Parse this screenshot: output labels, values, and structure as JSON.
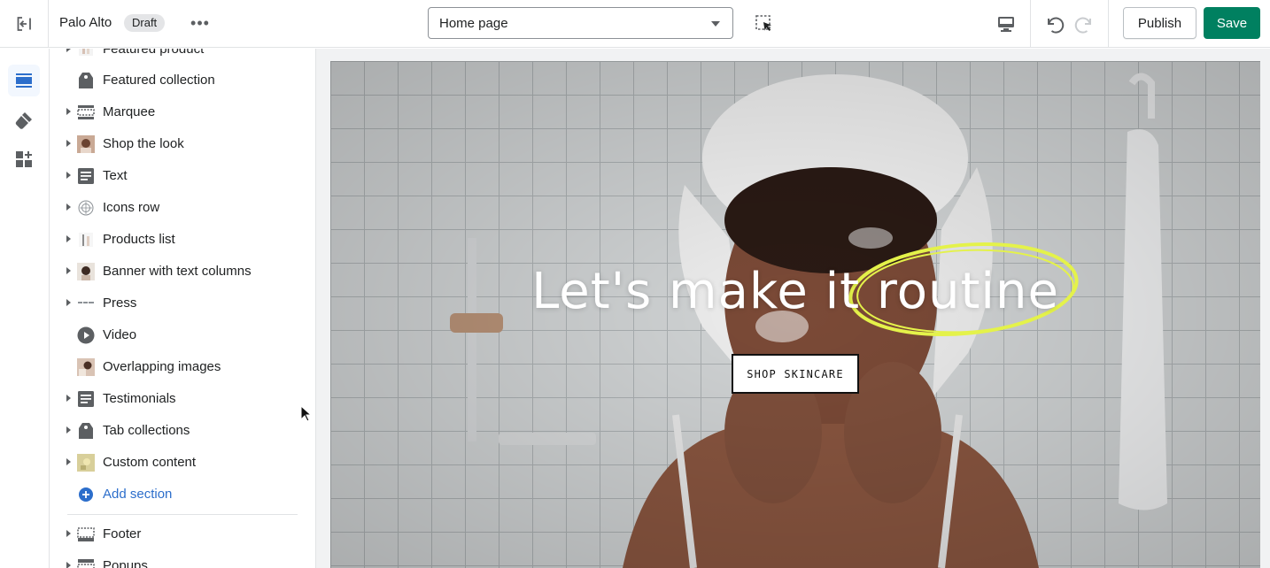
{
  "topbar": {
    "store_name": "Palo Alto",
    "status_badge": "Draft",
    "more_label": "•••",
    "page_selector": {
      "value": "Home page"
    },
    "publish_label": "Publish",
    "save_label": "Save"
  },
  "rail": {
    "items": [
      {
        "icon": "sections-icon",
        "active": true
      },
      {
        "icon": "theme-settings-icon",
        "active": false
      },
      {
        "icon": "apps-icon",
        "active": false
      }
    ]
  },
  "sections": {
    "items": [
      {
        "label": "Featured product",
        "icon": "product-thumbnail",
        "expandable": true
      },
      {
        "label": "Featured collection",
        "icon": "collection-tag-icon",
        "expandable": false
      },
      {
        "label": "Marquee",
        "icon": "marquee-icon",
        "expandable": true
      },
      {
        "label": "Shop the look",
        "icon": "photo-thumbnail",
        "expandable": true
      },
      {
        "label": "Text",
        "icon": "text-block-icon",
        "expandable": true
      },
      {
        "label": "Icons row",
        "icon": "icons-row-icon",
        "expandable": true
      },
      {
        "label": "Products list",
        "icon": "products-thumbnail",
        "expandable": true
      },
      {
        "label": "Banner with text columns",
        "icon": "photo-thumbnail",
        "expandable": true
      },
      {
        "label": "Press",
        "icon": "press-logos-thumbnail",
        "expandable": true
      },
      {
        "label": "Video",
        "icon": "play-icon",
        "expandable": false
      },
      {
        "label": "Overlapping images",
        "icon": "photo-thumbnail",
        "expandable": false
      },
      {
        "label": "Testimonials",
        "icon": "text-block-icon",
        "expandable": true
      },
      {
        "label": "Tab collections",
        "icon": "collection-tag-icon",
        "expandable": true
      },
      {
        "label": "Custom content",
        "icon": "custom-content-thumbnail",
        "expandable": true
      }
    ],
    "add_section_label": "Add section",
    "footer_items": [
      {
        "label": "Footer",
        "icon": "footer-icon",
        "expandable": true
      },
      {
        "label": "Popups",
        "icon": "popups-icon",
        "expandable": true
      }
    ]
  },
  "preview": {
    "hero_title": "Let's make it routine",
    "hero_button": "SHOP SKINCARE",
    "highlight_color": "#e4f24a"
  },
  "colors": {
    "primary": "#008060",
    "link": "#2c6ecb",
    "active_rail": "#2c6ecb"
  }
}
